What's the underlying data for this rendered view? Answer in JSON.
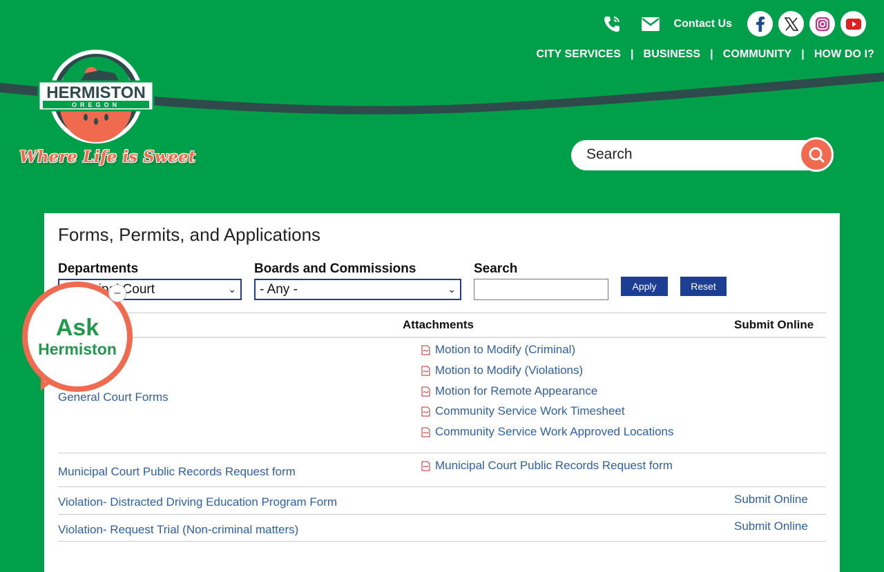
{
  "header": {
    "contact_label": "Contact Us",
    "nav": [
      {
        "label": "CITY SERVICES"
      },
      {
        "label": "BUSINESS"
      },
      {
        "label": "COMMUNITY"
      },
      {
        "label": "HOW DO I?"
      }
    ],
    "separator": "|",
    "logo": {
      "name": "HERMISTON",
      "sub": "OREGON"
    },
    "tagline": "Where Life is Sweet",
    "search_placeholder": "Search"
  },
  "page": {
    "title": "Forms, Permits, and Applications",
    "filters": {
      "departments_label": "Departments",
      "departments_value": "Municipal Court",
      "boards_label": "Boards and Commissions",
      "boards_value": "- Any -",
      "search_label": "Search",
      "apply": "Apply",
      "reset": "Reset"
    },
    "table": {
      "col_attachments": "Attachments",
      "col_submit": "Submit Online",
      "rows": [
        {
          "title": "General Court Forms",
          "attachments": [
            "Motion to Modify (Criminal)",
            "Motion to Modify (Violations)",
            "Motion for Remote Appearance",
            "Community Service Work Timesheet",
            "Community Service Work Approved Locations"
          ]
        },
        {
          "title": "Municipal Court Public Records Request form",
          "attachments": [
            "Municipal Court Public Records Request form"
          ]
        },
        {
          "title": "Violation- Distracted Driving Education Program Form",
          "submit": "Submit Online"
        },
        {
          "title": "Violation- Request Trial (Non-criminal matters)",
          "submit": "Submit Online"
        }
      ]
    }
  },
  "ask": {
    "line1": "Ask",
    "line2": "Hermiston",
    "minimize": "–"
  },
  "colors": {
    "brand_green": "#00a04b",
    "accent_orange": "#ef6a4f",
    "link_blue": "#2e5fa3",
    "button_blue": "#1c3f94"
  }
}
